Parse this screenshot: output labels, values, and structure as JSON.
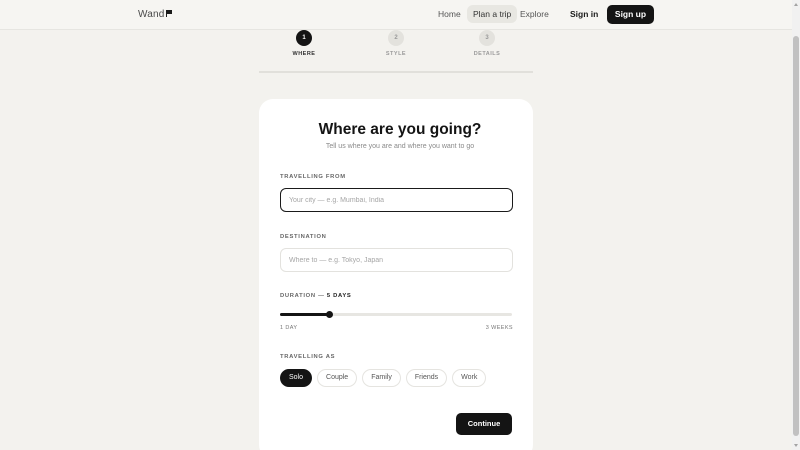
{
  "nav": {
    "logo": "Wand",
    "links": [
      {
        "label": "Home",
        "active": false
      },
      {
        "label": "Plan a trip",
        "active": true
      },
      {
        "label": "Explore",
        "active": false
      }
    ],
    "sign_in": "Sign in",
    "sign_up": "Sign up"
  },
  "stepper": [
    {
      "number": "1",
      "label": "WHERE",
      "active": true
    },
    {
      "number": "2",
      "label": "STYLE",
      "active": false
    },
    {
      "number": "3",
      "label": "DETAILS",
      "active": false
    }
  ],
  "card": {
    "title": "Where are you going?",
    "subtitle": "Tell us where you are and where you want to go",
    "from_label": "TRAVELLING FROM",
    "from_placeholder": "Your city — e.g. Mumbai, India",
    "from_value": "",
    "dest_label": "DESTINATION",
    "dest_placeholder": "Where to — e.g. Tokyo, Japan",
    "dest_value": "",
    "duration_label": "DURATION — ",
    "duration_value": "5 DAYS",
    "duration_fraction": 0.21,
    "slider_min": "1 DAY",
    "slider_max": "3 WEEKS",
    "travelling_as_label": "TRAVELLING AS",
    "travel_options": [
      "Solo",
      "Couple",
      "Family",
      "Friends",
      "Work"
    ],
    "selected_option": "Solo",
    "continue": "Continue"
  },
  "colors": {
    "background": "#f3f2ee",
    "card": "#ffffff",
    "accent": "#141414"
  }
}
